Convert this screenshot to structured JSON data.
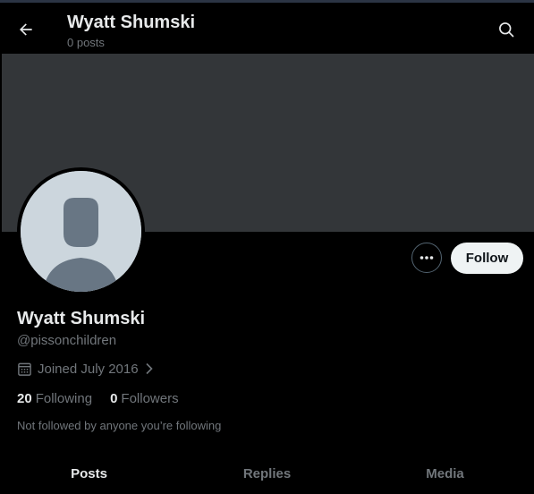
{
  "header": {
    "title": "Wyatt Shumski",
    "subtitle": "0 posts",
    "back_icon": "arrow-left-icon",
    "search_icon": "search-icon"
  },
  "profile": {
    "display_name": "Wyatt Shumski",
    "handle": "@pissonchildren",
    "joined": "Joined July 2016",
    "following_count": "20",
    "following_label": "Following",
    "followers_count": "0",
    "followers_label": "Followers",
    "not_followed_text": "Not followed by anyone you’re following",
    "follow_label": "Follow"
  },
  "tabs": [
    {
      "label": "Posts",
      "active": true
    },
    {
      "label": "Replies",
      "active": false
    },
    {
      "label": "Media",
      "active": false
    }
  ],
  "colors": {
    "background": "#000000",
    "banner": "#333639",
    "primary_text": "#e7e9ea",
    "secondary_text": "#71767b",
    "follow_button_bg": "#eff3f4",
    "avatar_bg": "#ccd6dd",
    "avatar_silhouette": "#687684"
  }
}
